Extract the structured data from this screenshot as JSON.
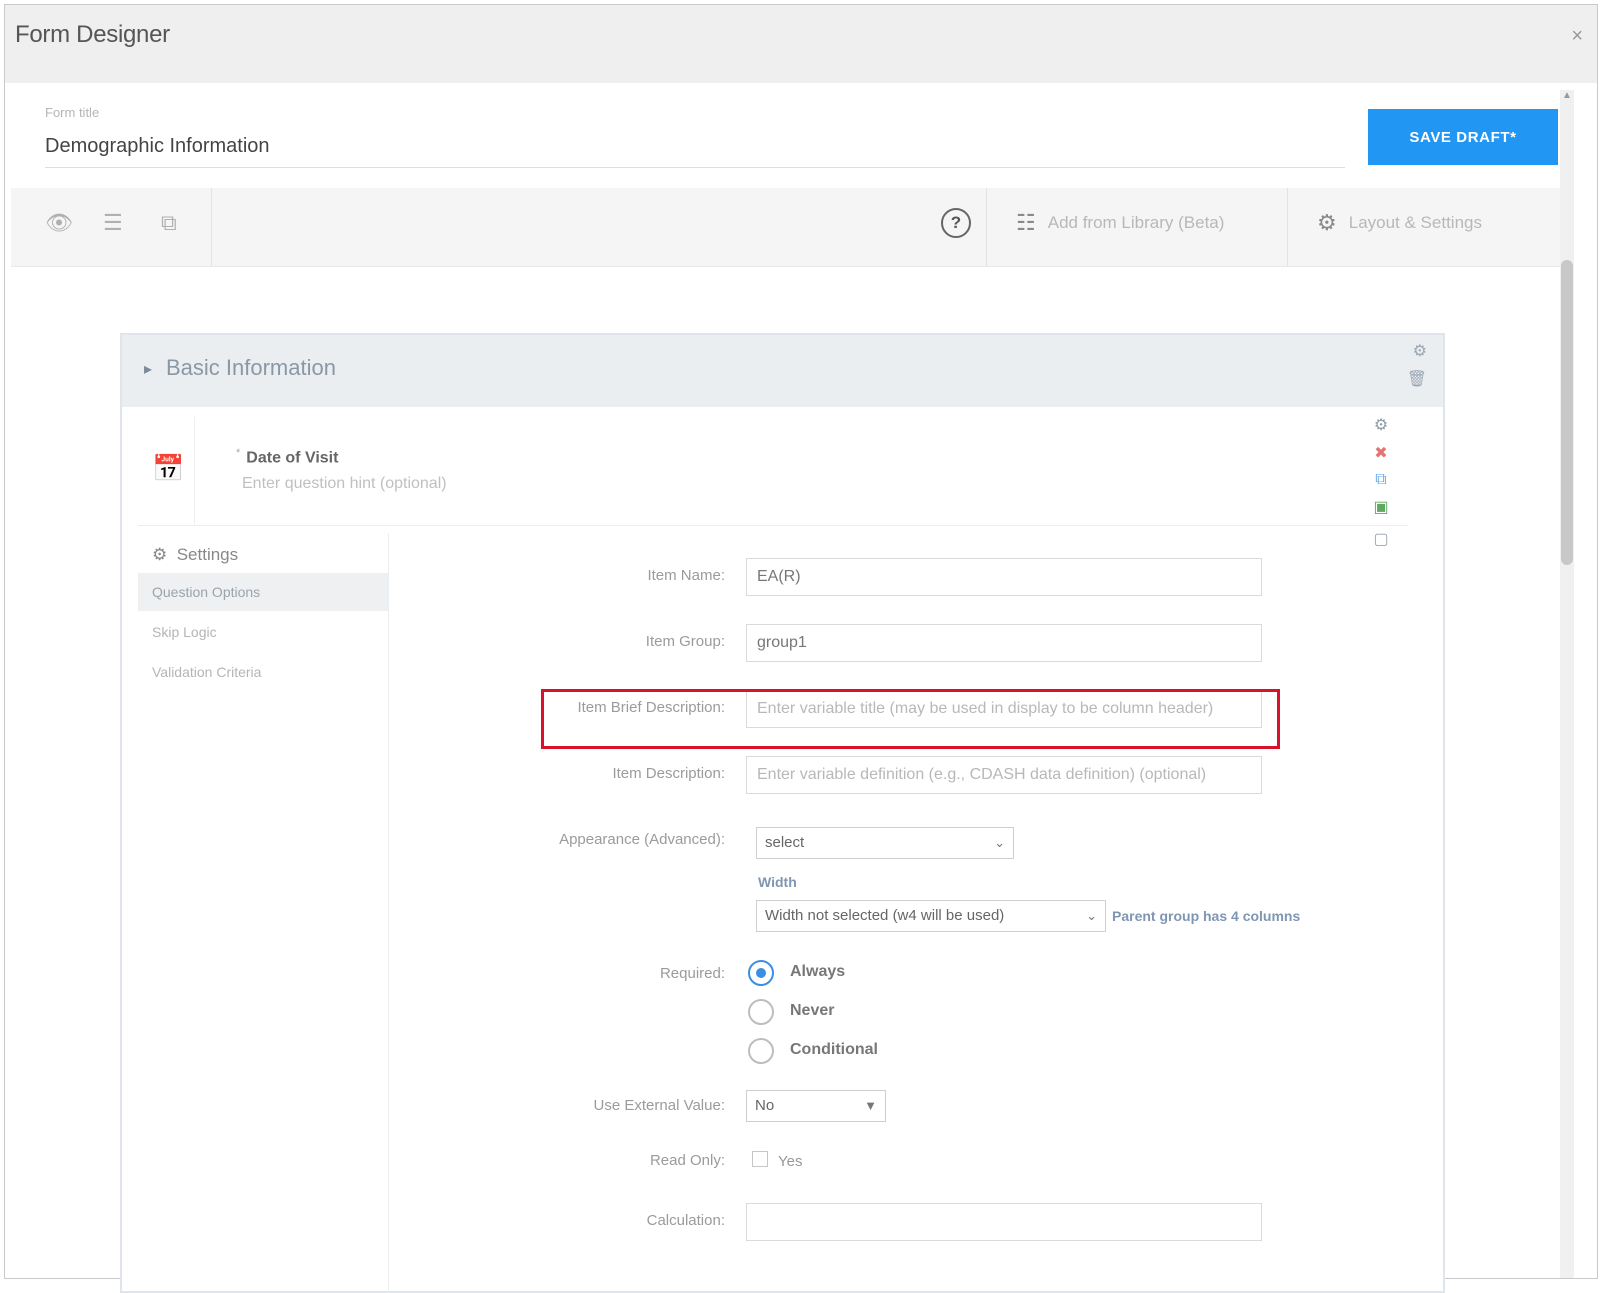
{
  "window": {
    "title": "Form Designer",
    "close_glyph": "×"
  },
  "header": {
    "form_title_label": "Form title",
    "form_title_value": "Demographic Information",
    "save_label": "SAVE DRAFT*"
  },
  "toolbar": {
    "icons": [
      "eye-icon",
      "list-icon",
      "copy-icon"
    ],
    "help_glyph": "?",
    "add_library_label": "Add from Library (Beta)",
    "layout_settings_label": "Layout & Settings"
  },
  "panel": {
    "caret": "▸",
    "title": "Basic Information",
    "question": {
      "required_mark": "*",
      "title": "Date of Visit",
      "subtitle_placeholder": "Enter question hint (optional)"
    }
  },
  "settings_nav": {
    "header": "Settings",
    "items": [
      {
        "label": "Question Options",
        "active": true
      },
      {
        "label": "Skip Logic",
        "active": false
      },
      {
        "label": "Validation Criteria",
        "active": false
      }
    ]
  },
  "fields": {
    "item_name": {
      "label": "Item Name:",
      "value": "EA(R)"
    },
    "item_group": {
      "label": "Item Group:",
      "value": "group1"
    },
    "item_brief_description": {
      "label": "Item Brief Description:",
      "placeholder": "Enter variable title (may be used in display to be column header)"
    },
    "item_description": {
      "label": "Item Description:",
      "placeholder": "Enter variable definition (e.g., CDASH data definition) (optional)"
    },
    "appearance": {
      "label": "Appearance (Advanced):",
      "value": "select"
    },
    "width": {
      "label": "Width",
      "value": "Width not selected (w4 will be used)",
      "note": "Parent group has 4 columns"
    },
    "required": {
      "label": "Required:",
      "options": [
        "Always",
        "Never",
        "Conditional"
      ],
      "selected": "Always"
    },
    "use_external_value": {
      "label": "Use External Value:",
      "value": "No"
    },
    "read_only": {
      "label": "Read Only:",
      "option": "Yes"
    },
    "calculation": {
      "label": "Calculation:",
      "value": ""
    }
  },
  "colors": {
    "accent": "#2196f3",
    "highlight": "#d8122a"
  }
}
